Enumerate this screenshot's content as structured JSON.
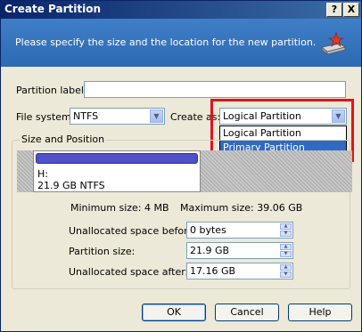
{
  "window": {
    "title": "Create Partition",
    "help_btn": "?",
    "close_btn": "X"
  },
  "banner": {
    "description": "Please specify the size and the location for the new partition.",
    "icon": "drive-with-star-icon"
  },
  "form": {
    "partition_label": {
      "label": "Partition label:",
      "value": ""
    },
    "file_system": {
      "label": "File system:",
      "value": "NTFS"
    },
    "create_as": {
      "label": "Create as:",
      "value": "Logical Partition",
      "options": [
        "Logical Partition",
        "Primary Partition"
      ],
      "highlighted": "Primary Partition"
    }
  },
  "size_position": {
    "legend": "Size and Position",
    "partition": {
      "name": "H:",
      "info": "21.9 GB  NTFS"
    },
    "min_size": "Minimum size: 4 MB",
    "max_size": "Maximum size: 39.06 GB",
    "unalloc_before": {
      "label": "Unallocated space before:",
      "value": "0 bytes"
    },
    "partition_size": {
      "label": "Partition size:",
      "value": "21.9 GB"
    },
    "unalloc_after": {
      "label": "Unallocated space after:",
      "value": "17.16 GB"
    }
  },
  "buttons": {
    "ok": "OK",
    "cancel": "Cancel",
    "help": "Help"
  },
  "colors": {
    "highlight_border": "#e2141b",
    "banner": "#2d69b4",
    "selection": "#316ac5",
    "partition_bar": "#5050c8"
  }
}
